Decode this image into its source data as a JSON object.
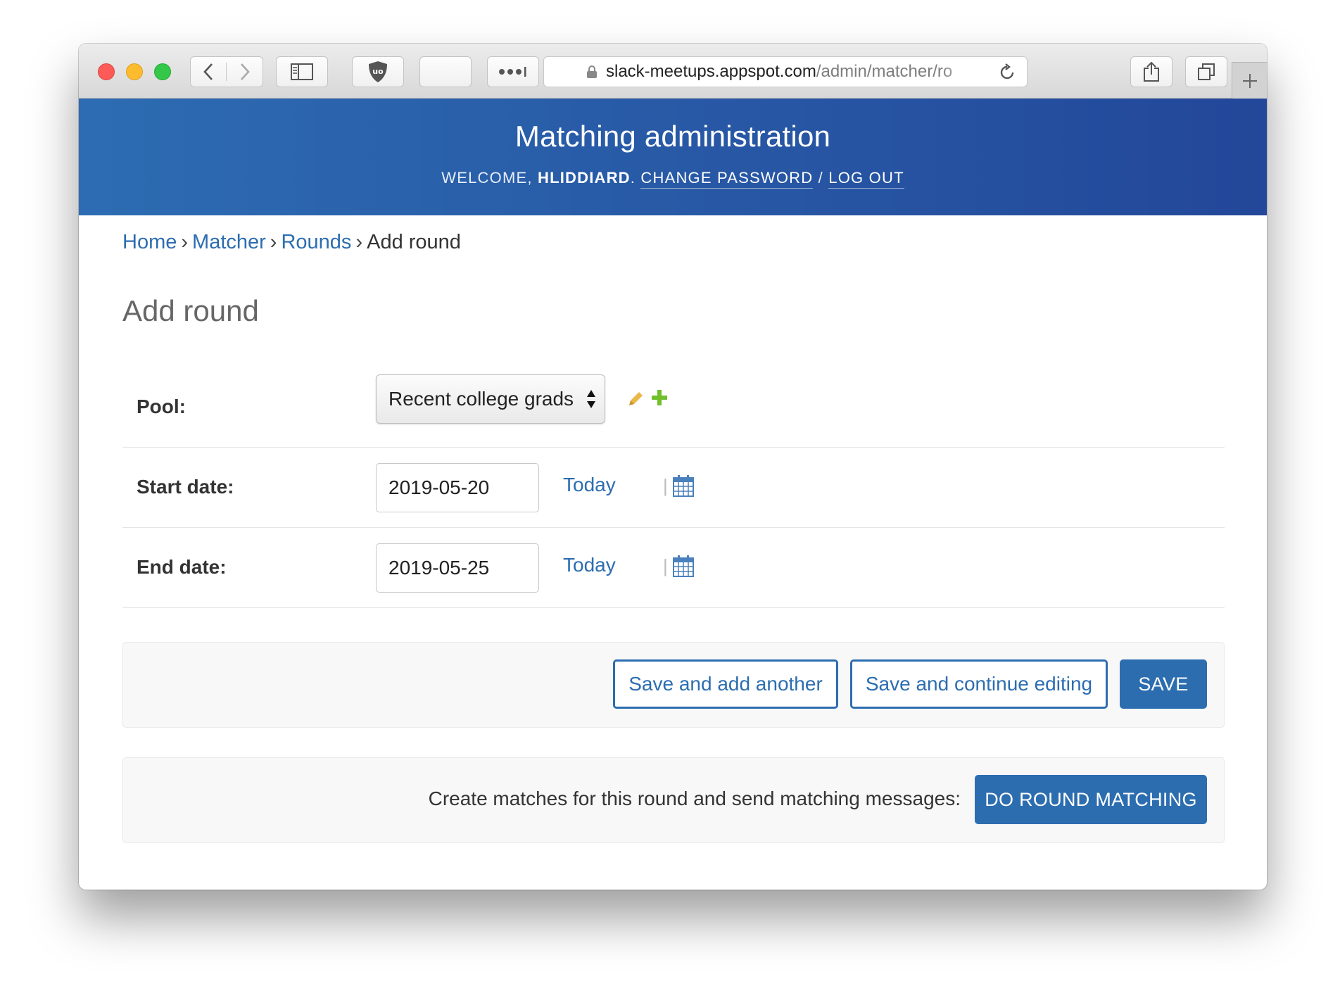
{
  "browser": {
    "url_host": "slack-meetups.appspot.com",
    "url_path": "/admin/matcher/ro"
  },
  "header": {
    "site_title": "Matching administration",
    "welcome": "Welcome,",
    "username": "hliddiard",
    "change_password": "Change password",
    "separator": "/",
    "log_out": "Log out"
  },
  "breadcrumbs": {
    "items": [
      "Home",
      "Matcher",
      "Rounds",
      "Add round"
    ],
    "separator": "›"
  },
  "page_title": "Add round",
  "form": {
    "pool": {
      "label": "Pool:",
      "value": "Recent college grads"
    },
    "start_date": {
      "label": "Start date:",
      "value": "2019-05-20",
      "shortcut": "Today",
      "pipe": "|"
    },
    "end_date": {
      "label": "End date:",
      "value": "2019-05-25",
      "shortcut": "Today",
      "pipe": "|"
    }
  },
  "submit": {
    "save_add_another": "Save and add another",
    "save_continue": "Save and continue editing",
    "save": "Save"
  },
  "matching": {
    "label": "Create matches for this round and send matching messages:",
    "button": "Do round matching"
  },
  "colors": {
    "accent": "#2c6db0",
    "header_start": "#2d6cb2",
    "header_end": "#23479a",
    "edit_icon": "#e8b94a",
    "add_icon": "#70bf2b"
  }
}
